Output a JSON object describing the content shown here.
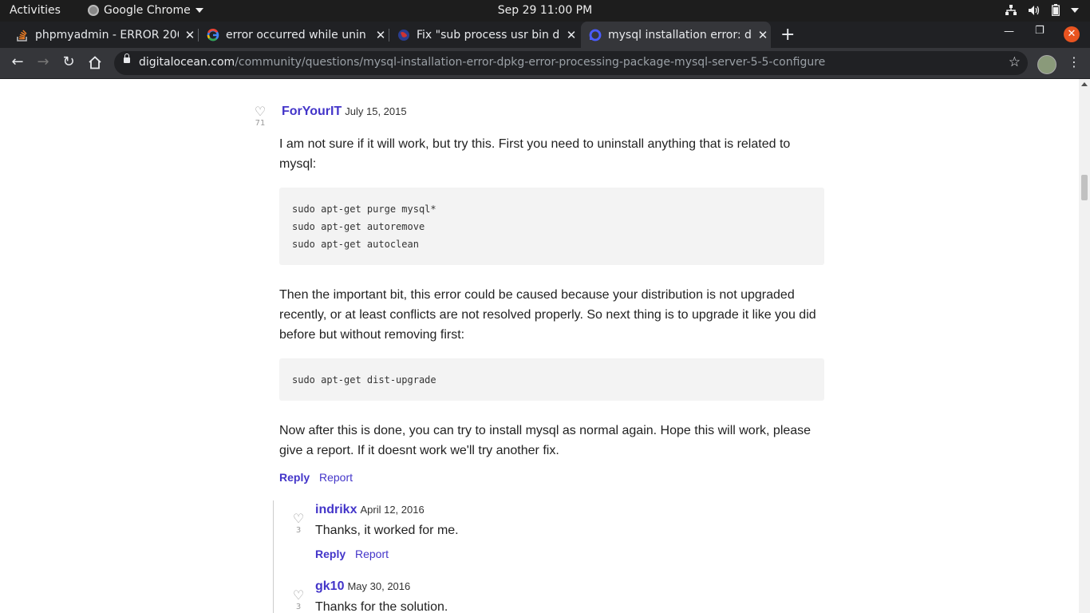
{
  "os_topbar": {
    "activities": "Activities",
    "app_menu": "Google Chrome",
    "clock": "Sep 29  11:00 PM"
  },
  "browser": {
    "tabs": [
      {
        "title": "phpmyadmin - ERROR 200",
        "favicon": "stackoverflow-icon"
      },
      {
        "title": "error occurred while unin",
        "favicon": "google-icon"
      },
      {
        "title": "Fix \"sub process usr bin d",
        "favicon": "globe-icon"
      },
      {
        "title": "mysql installation error: d",
        "favicon": "digitalocean-icon",
        "active": true
      }
    ],
    "url_host": "digitalocean.com",
    "url_path": "/community/questions/mysql-installation-error-dpkg-error-processing-package-mysql-server-5-5-configure"
  },
  "answer": {
    "author": "ForYourIT",
    "date": "July 15, 2015",
    "votes": "71",
    "p1": "I am not sure if it will work, but try this. First you need to uninstall anything that is related to mysql:",
    "code1": [
      "sudo apt-get purge mysql*",
      "sudo apt-get autoremove",
      "sudo apt-get autoclean"
    ],
    "p2": "Then the important bit, this error could be caused because your distribution is not upgraded recently, or at least conflicts are not resolved properly. So next thing is to upgrade it like you did before but without removing first:",
    "code2": [
      "sudo apt-get dist-upgrade"
    ],
    "p3": "Now after this is done, you can try to install mysql as normal again. Hope this will work, please give a report. If it doesnt work we'll try another fix.",
    "reply_label": "Reply",
    "report_label": "Report"
  },
  "comments": [
    {
      "author": "indrikx",
      "date": "April 12, 2016",
      "votes": "3",
      "text": "Thanks, it worked for me.",
      "reply_label": "Reply",
      "report_label": "Report"
    },
    {
      "author": "gk10",
      "date": "May 30, 2016",
      "votes": "3",
      "text": "Thanks for the solution."
    }
  ]
}
